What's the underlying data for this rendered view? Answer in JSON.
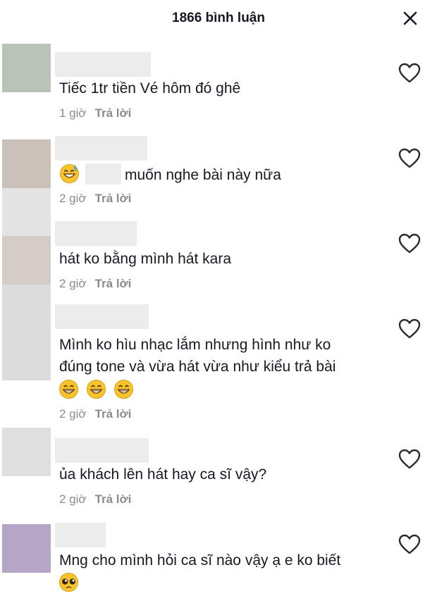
{
  "header": {
    "title": "1866 bình luận",
    "close_icon": "close-icon"
  },
  "colors": {
    "avatar_1": "#b9c3b8",
    "avatar_2": "#cbc1b8",
    "avatar_3": "#d5ccc7",
    "avatar_4": "#dcdcdc",
    "avatar_5": "#e0dfe0",
    "avatar_6": "#b7a5c8"
  },
  "comments": [
    {
      "text": "Tiếc 1tr tiền Vé hôm đó ghê",
      "time": "1 giờ",
      "reply": "Trả lời"
    },
    {
      "text": "muốn nghe bài này nữa",
      "time": "2 giờ",
      "reply": "Trả lời"
    },
    {
      "text": "hát ko bằng mình hát kara",
      "time": "2 giờ",
      "reply": "Trả lời"
    },
    {
      "line1": "Mình ko hìu nhạc lắm nhưng hình như ko",
      "line2": "đúng tone và vừa hát vừa như kiểu trả bài",
      "time": "2 giờ",
      "reply": "Trả lời"
    },
    {
      "text": "ủa khách lên hát hay ca sĩ vậy?",
      "time": "2 giờ",
      "reply": "Trả lời"
    },
    {
      "text": "Mng cho mình hỏi ca sĩ nào vậy ạ e ko biết"
    }
  ]
}
